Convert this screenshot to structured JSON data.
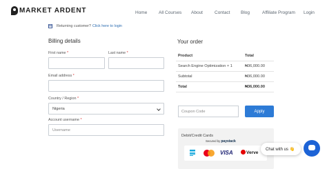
{
  "brand": {
    "name": "MARKET ARDENT"
  },
  "nav": {
    "items": [
      {
        "label": "Home"
      },
      {
        "label": "All Courses"
      },
      {
        "label": "About"
      },
      {
        "label": "Contact"
      },
      {
        "label": "Blog"
      },
      {
        "label": "Affiliate Program"
      },
      {
        "label": "Login"
      }
    ]
  },
  "notice": {
    "text": "Returning customer?",
    "link": "Click here to login"
  },
  "billing": {
    "title": "Billing details",
    "first_name_label": "First name",
    "last_name_label": "Last name",
    "email_label": "Email address",
    "country_label": "Country / Region",
    "country_value": "Nigeria",
    "username_label": "Account username",
    "username_placeholder": "Username",
    "required_mark": "*"
  },
  "order": {
    "title": "Your order",
    "header": {
      "product": "Product",
      "total": "Total"
    },
    "rows": [
      {
        "name": "Search Engine Optimization × 1",
        "total": "₦36,000.00"
      },
      {
        "name": "Subtotal",
        "total": "₦36,000.00"
      },
      {
        "name": "Total",
        "total": "₦36,000.00"
      }
    ]
  },
  "coupon": {
    "placeholder": "Coupon Code",
    "apply_label": "Apply"
  },
  "payment": {
    "title": "Debit/Credit Cards",
    "secured_prefix": "Secured by",
    "secured_brand": "paystack",
    "logos": [
      "paystack-icon",
      "mastercard-icon",
      "visa-icon",
      "verve-icon"
    ],
    "visa_text": "VISA",
    "verve_text": "Verve"
  },
  "chat": {
    "label": "Chat with us 👋"
  },
  "colors": {
    "accent": "#2d7bd6",
    "chat_button": "#1d63d6"
  }
}
